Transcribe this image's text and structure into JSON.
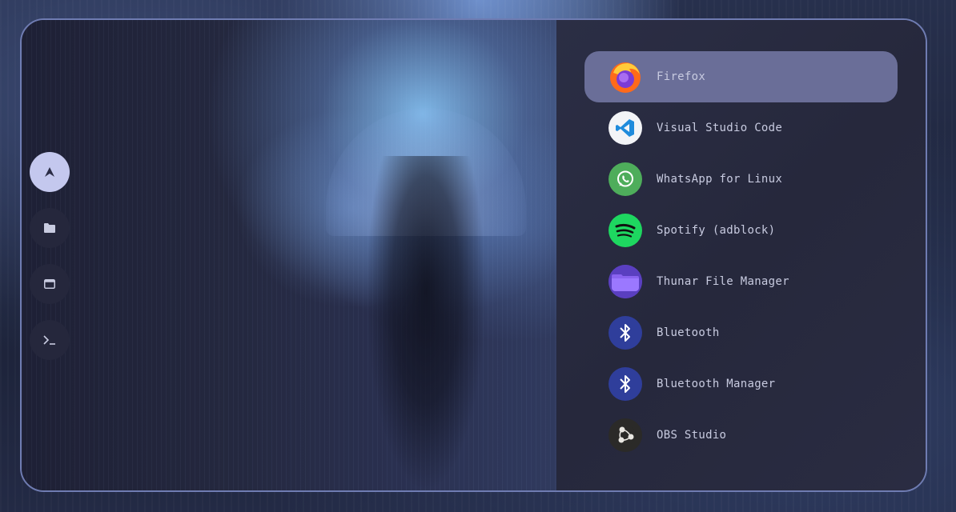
{
  "sidebar": {
    "items": [
      {
        "icon": "arch-logo-icon",
        "active": true
      },
      {
        "icon": "folder-icon",
        "active": false
      },
      {
        "icon": "window-icon",
        "active": false
      },
      {
        "icon": "terminal-icon",
        "active": false
      }
    ]
  },
  "apps": [
    {
      "label": "Firefox",
      "icon": "firefox-icon",
      "selected": true
    },
    {
      "label": "Visual Studio Code",
      "icon": "vscode-icon",
      "selected": false
    },
    {
      "label": "WhatsApp for Linux",
      "icon": "whatsapp-icon",
      "selected": false
    },
    {
      "label": "Spotify (adblock)",
      "icon": "spotify-icon",
      "selected": false
    },
    {
      "label": "Thunar File Manager",
      "icon": "thunar-icon",
      "selected": false
    },
    {
      "label": "Bluetooth",
      "icon": "bluetooth-icon",
      "selected": false
    },
    {
      "label": "Bluetooth Manager",
      "icon": "bluetooth-icon",
      "selected": false
    },
    {
      "label": "OBS Studio",
      "icon": "obs-icon",
      "selected": false
    }
  ],
  "colors": {
    "border": "#6f7cb2",
    "selected_bg": "#6a6e98",
    "active_side_btn": "#c4c8ee",
    "text": "#c8cbe0"
  }
}
